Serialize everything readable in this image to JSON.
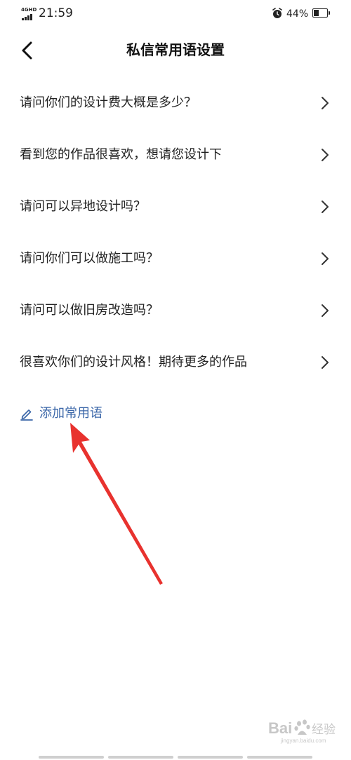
{
  "status_bar": {
    "network": "4GHD",
    "time": "21:59",
    "battery_percent": "44%",
    "battery_level": 0.44,
    "icons": [
      "signal-icon",
      "alarm-icon",
      "battery-icon"
    ]
  },
  "header": {
    "title": "私信常用语设置",
    "back_icon": "back-chevron-icon"
  },
  "phrases": [
    {
      "label": "请问你们的设计费大概是多少？"
    },
    {
      "label": "看到您的作品很喜欢，想请您设计下"
    },
    {
      "label": "请问可以异地设计吗？"
    },
    {
      "label": "请问你们可以做施工吗？"
    },
    {
      "label": "请问可以做旧房改造吗？"
    },
    {
      "label": "很喜欢你们的设计风格！期待更多的作品"
    }
  ],
  "add_phrase": {
    "label": "添加常用语",
    "icon": "edit-icon"
  },
  "colors": {
    "accent": "#3a66a8",
    "annotation_arrow": "#e8322e",
    "text": "#222222"
  },
  "watermark": {
    "text": "Bai经验",
    "subtext": "jingyan.baidu.com"
  }
}
